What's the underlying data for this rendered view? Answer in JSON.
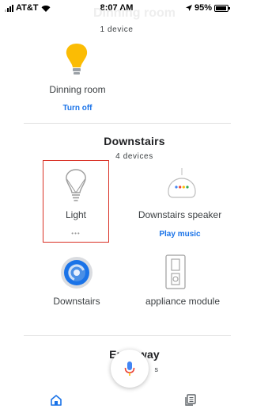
{
  "status_bar": {
    "carrier": "AT&T",
    "time": "8:07 AM",
    "battery": "95%",
    "battery_level": 0.95
  },
  "header": {
    "ghost_title": "Dinning room",
    "device_count": "1 device"
  },
  "rooms": [
    {
      "name": "Dinning room",
      "devices": [
        {
          "label": "Dinning room",
          "action": "Turn off",
          "icon": "lightbulb-on-icon"
        }
      ]
    },
    {
      "name": "Downstairs",
      "count": "4 devices",
      "devices": [
        {
          "label": "Light",
          "icon": "lightbulb-outline-icon",
          "more": "•••"
        },
        {
          "label": "Downstairs speaker",
          "action": "Play music",
          "icon": "smart-speaker-icon"
        },
        {
          "label": "Downstairs",
          "icon": "thermostat-icon"
        },
        {
          "label": "appliance module",
          "icon": "appliance-module-icon"
        }
      ]
    },
    {
      "name": "Entryway",
      "count_left": "3",
      "count_right": "s"
    }
  ],
  "colors": {
    "accent": "#1a73e8",
    "bulb_on": "#fbbc04",
    "highlight_border": "#d93025"
  },
  "nav": {
    "home_icon": "home-icon",
    "mic_icon": "mic-icon",
    "rooms_icon": "rooms-list-icon"
  }
}
